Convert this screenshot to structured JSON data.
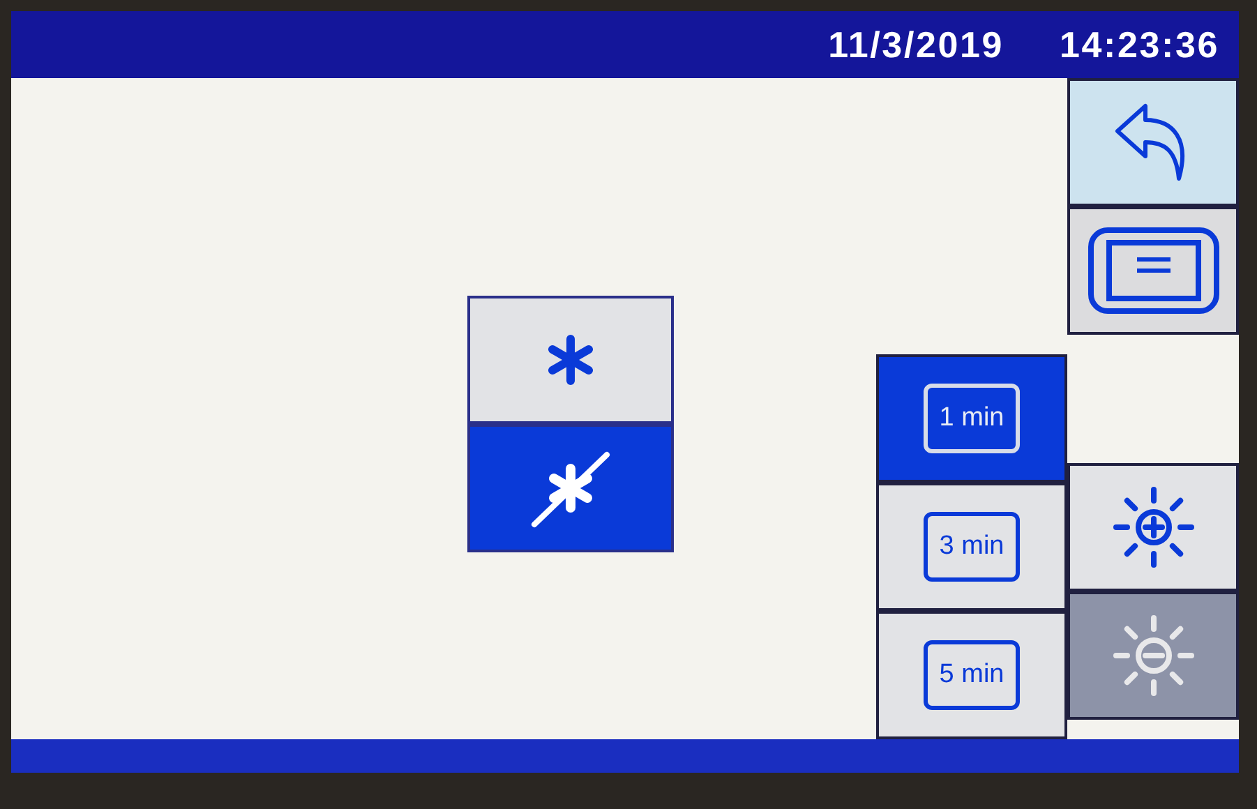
{
  "status_bar": {
    "date": "11/3/2019",
    "time": "14:23:36"
  },
  "snow_modes": [
    {
      "kind": "asterisk",
      "selected": false
    },
    {
      "kind": "asterisk-crossed",
      "selected": true
    }
  ],
  "timers": [
    {
      "label": "1 min",
      "selected": true
    },
    {
      "label": "3 min",
      "selected": false
    },
    {
      "label": "5 min",
      "selected": false
    }
  ],
  "brightness": [
    {
      "kind": "increase",
      "disabled": false
    },
    {
      "kind": "decrease",
      "disabled": true
    }
  ]
}
